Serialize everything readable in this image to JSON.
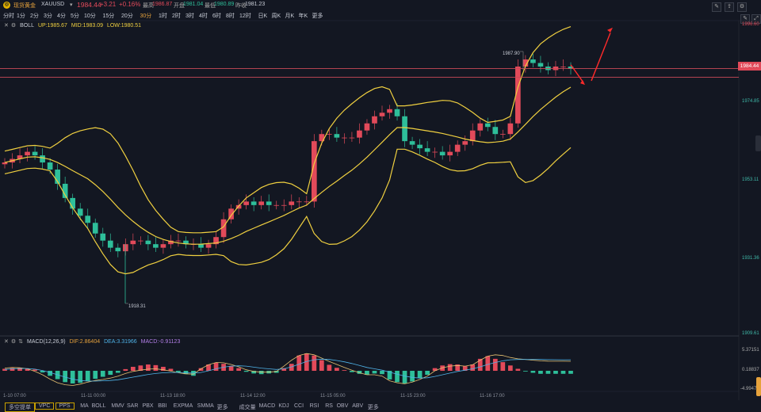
{
  "header": {
    "name": "现货黄金",
    "symbol": "XAUUSD",
    "dropdown": "▾",
    "price": "1984.44",
    "change": "+3.21",
    "change_pct": "+0.16%",
    "high_label": "最高",
    "high": "1986.87",
    "open_label": "开盘",
    "open": "1981.04",
    "low_label": "最低",
    "low": "1980.89",
    "prev_label": "昨收",
    "prev": "1981.23"
  },
  "timeframes": [
    "分时",
    "1分",
    "2分",
    "3分",
    "4分",
    "5分",
    "10分",
    "15分",
    "20分",
    "30分",
    "1时",
    "2时",
    "3时",
    "4时",
    "6时",
    "8时",
    "12时",
    "日K",
    "周K",
    "月K",
    "年K",
    "更多"
  ],
  "active_timeframe": "30分",
  "boll": {
    "name": "BOLL",
    "up": "UP:1985.67",
    "mid": "MID:1983.09",
    "low": "LOW:1980.51"
  },
  "macd": {
    "name": "MACD(12,26,9)",
    "dif": "DIF:2.86404",
    "dea": "DEA:3.31966",
    "macd": "MACD:-0.91123"
  },
  "price_axis": [
    "1996.60",
    "1974.85",
    "1953.11",
    "1931.36",
    "1909.61"
  ],
  "current_price_tag": "1984.44",
  "macd_axis": [
    "5.37151",
    "0.18837",
    "-4.9947"
  ],
  "annotations": {
    "high": "1987.90",
    "low": "1918.31"
  },
  "time_axis": [
    "1-10 07:00",
    "11-11 00:00",
    "11-13 18:00",
    "11-14 12:00",
    "11-15 05:00",
    "11-15 23:00",
    "11-16 17:00"
  ],
  "bottom_bar": {
    "buttons": [
      "多空提单",
      "VPC",
      "PPS"
    ],
    "main_indicators": [
      "MA",
      "BOLL",
      "MMV",
      "SAR",
      "PBX",
      "BBI",
      "EXPMA",
      "SMMA",
      "更多"
    ],
    "sub_indicators": [
      "成交量",
      "MACD",
      "KDJ",
      "CCI",
      "RSI",
      "RS",
      "OBV",
      "ABV",
      "更多"
    ]
  },
  "colors": {
    "up": "#e24a5a",
    "down": "#2ebf9a",
    "boll": "#f0d040",
    "accent": "#e6a23c",
    "bg": "#131722"
  },
  "chart_data": {
    "type": "candlestick",
    "ylim": [
      1909.61,
      1996.6
    ],
    "price_lines": [
      1984.44,
      1982.0
    ],
    "close": [
      1958,
      1959,
      1960,
      1961,
      1960,
      1958,
      1956,
      1952,
      1948,
      1945,
      1943,
      1941,
      1938,
      1936,
      1934,
      1933,
      1935,
      1936,
      1936,
      1935,
      1934,
      1935,
      1936,
      1936,
      1935,
      1935,
      1934,
      1935,
      1937,
      1942,
      1945,
      1946,
      1947,
      1946,
      1947,
      1946,
      1946,
      1946,
      1947,
      1947,
      1947,
      1964,
      1966,
      1966,
      1965,
      1965,
      1965,
      1967,
      1969,
      1971,
      1972,
      1973,
      1971,
      1964,
      1963,
      1962,
      1961,
      1961,
      1960,
      1961,
      1963,
      1964,
      1967,
      1969,
      1968,
      1966,
      1966,
      1969,
      1985,
      1987,
      1986,
      1985,
      1984,
      1985,
      1985,
      1984.44
    ],
    "macd_hist": [
      0.6,
      0.8,
      0.9,
      0.7,
      0.4,
      -0.5,
      -1.5,
      -2.5,
      -3.4,
      -3.8,
      -3.6,
      -3.0,
      -2.4,
      -1.8,
      -1.2,
      -0.6,
      0.5,
      1.2,
      1.6,
      1.9,
      1.7,
      1.2,
      0.6,
      -0.4,
      -1.0,
      -1.5,
      0.8,
      1.9,
      2.4,
      2.1,
      1.5,
      0.8,
      -0.3,
      -0.8,
      -1.0,
      -0.8,
      -0.6,
      0.8,
      2.1,
      4.6,
      5.2,
      4.6,
      3.2,
      1.8,
      0.9,
      0.2,
      -0.4,
      -0.9,
      -1.2,
      -0.8,
      -1.0,
      -2.6,
      -3.4,
      -3.8,
      -3.2,
      -2.2,
      -1.2,
      0.8,
      1.6,
      2.0,
      1.9,
      1.4,
      1.9,
      3.6,
      4.4,
      3.6,
      2.6,
      1.6,
      0.6,
      -0.2,
      -0.6,
      -0.9,
      -0.9,
      -0.9,
      -0.9,
      -0.9
    ],
    "macd_dif": [
      0.8,
      1.0,
      0.9,
      0.6,
      -0.2,
      -1.2,
      -2.5,
      -3.6,
      -4.2,
      -4.4,
      -4.0,
      -3.4,
      -2.9,
      -2.6,
      -2.2,
      -1.6,
      -0.8,
      -0.2,
      0.2,
      0.5,
      0.6,
      0.3,
      -0.1,
      -0.6,
      -0.9,
      -1.0,
      0.6,
      1.8,
      2.5,
      2.4,
      1.9,
      1.2,
      0.3,
      -0.2,
      -0.4,
      -0.4,
      -0.2,
      1.4,
      3.2,
      4.6,
      5.2,
      4.8,
      3.8,
      2.8,
      1.9,
      1.0,
      0.2,
      -0.6,
      -1.2,
      -1.2,
      -1.6,
      -3.0,
      -3.6,
      -3.9,
      -3.4,
      -2.6,
      -1.6,
      0.0,
      0.9,
      1.4,
      1.6,
      1.4,
      1.8,
      3.2,
      4.4,
      4.8,
      4.6,
      4.0,
      3.6,
      3.4,
      3.2,
      3.0,
      2.9,
      2.88,
      2.87,
      2.86
    ],
    "macd_dea": [
      0.4,
      0.6,
      0.7,
      0.7,
      0.5,
      0.1,
      -0.5,
      -1.2,
      -1.9,
      -2.5,
      -2.9,
      -3.1,
      -3.1,
      -3.0,
      -2.9,
      -2.7,
      -2.3,
      -1.9,
      -1.5,
      -1.1,
      -0.8,
      -0.6,
      -0.5,
      -0.5,
      -0.6,
      -0.7,
      -0.5,
      0.0,
      0.6,
      1.1,
      1.4,
      1.5,
      1.4,
      1.1,
      0.8,
      0.6,
      0.4,
      0.6,
      1.2,
      2.0,
      2.8,
      3.3,
      3.5,
      3.4,
      3.1,
      2.7,
      2.2,
      1.6,
      1.0,
      0.6,
      0.2,
      -0.4,
      -1.0,
      -1.6,
      -2.0,
      -2.2,
      -2.1,
      -1.7,
      -1.2,
      -0.7,
      -0.2,
      0.2,
      0.6,
      1.2,
      1.9,
      2.5,
      3.0,
      3.3,
      3.4,
      3.4,
      3.4,
      3.4,
      3.35,
      3.33,
      3.32,
      3.31966
    ]
  }
}
